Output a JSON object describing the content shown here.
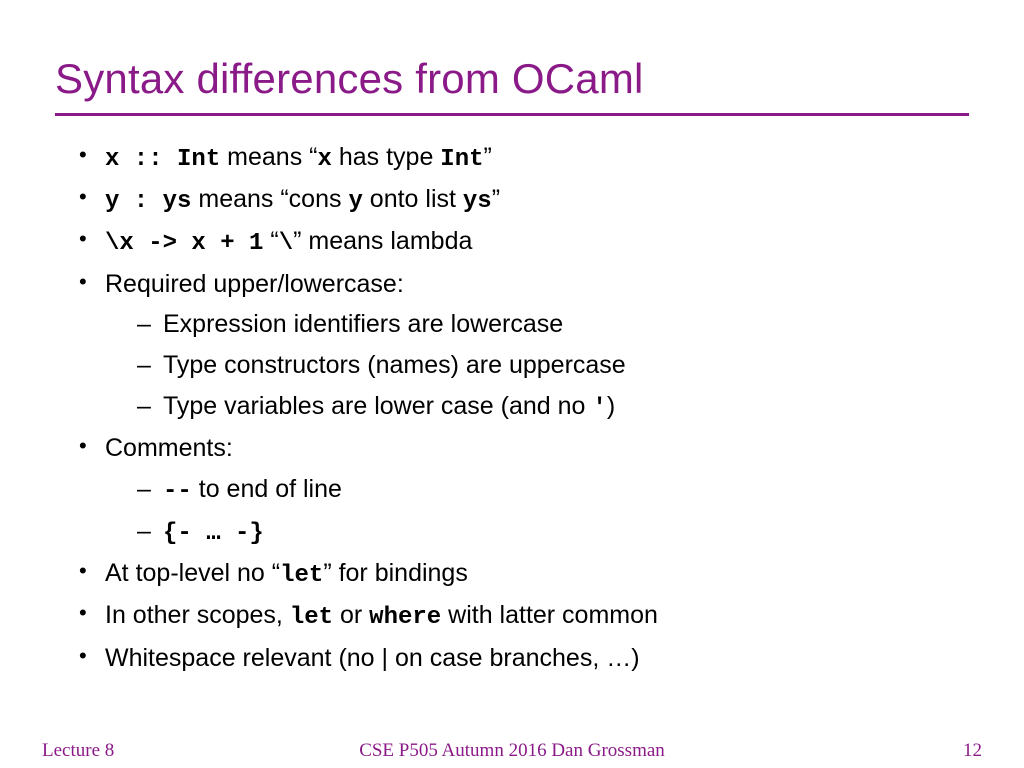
{
  "title": "Syntax differences from OCaml",
  "b1": {
    "code": "x :: Int",
    "t1": "  means “",
    "c2": "x",
    "t2": " has type ",
    "c3": "Int",
    "t3": "”"
  },
  "b2": {
    "code": "y : ys",
    "t1": "  means “cons ",
    "c2": "y",
    "t2": " onto list ",
    "c3": "ys",
    "t3": "”"
  },
  "b3": {
    "code": "\\x -> x + 1",
    "t1": "  “",
    "c2": "\\",
    "t2": "” means lambda"
  },
  "b4": {
    "text": "Required upper/lowercase:"
  },
  "b4s1": "Expression identifiers are lowercase",
  "b4s2": "Type constructors (names) are uppercase",
  "b4s3a": "Type variables are lower case (and no ",
  "b4s3c": "'",
  "b4s3b": ")",
  "b5": {
    "text": "Comments:"
  },
  "b5s1a": "--",
  "b5s1b": " to end of line",
  "b5s2": "{- … -}",
  "b6a": "At top-level no “",
  "b6c": "let",
  "b6b": "” for bindings",
  "b7a": "In other scopes, ",
  "b7c1": "let",
  "b7b": " or ",
  "b7c2": "where",
  "b7d": " with latter common",
  "b8": "Whitespace relevant (no | on case branches, …)",
  "footer": {
    "left": "Lecture 8",
    "center": "CSE P505 Autumn 2016  Dan Grossman",
    "right": "12"
  }
}
